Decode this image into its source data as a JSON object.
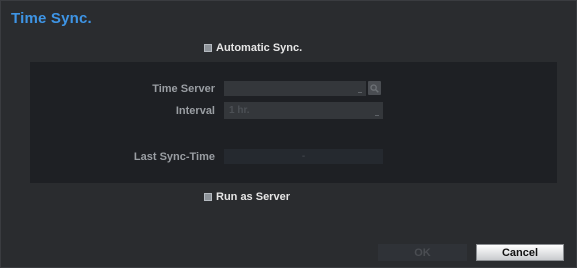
{
  "dialog": {
    "title": "Time Sync."
  },
  "automatic_sync": {
    "label": "Automatic Sync.",
    "checked": false
  },
  "time_server": {
    "label": "Time Server",
    "value": ""
  },
  "interval": {
    "label": "Interval",
    "value": "1 hr."
  },
  "last_sync": {
    "label": "Last Sync-Time",
    "value": "-"
  },
  "run_as_server": {
    "label": "Run as Server",
    "checked": false
  },
  "buttons": {
    "ok": "OK",
    "cancel": "Cancel"
  },
  "icons": {
    "server_lookup": "search-icon"
  },
  "colors": {
    "title": "#3e95e6",
    "background": "#2a2c2f",
    "panel": "#1e2024"
  }
}
